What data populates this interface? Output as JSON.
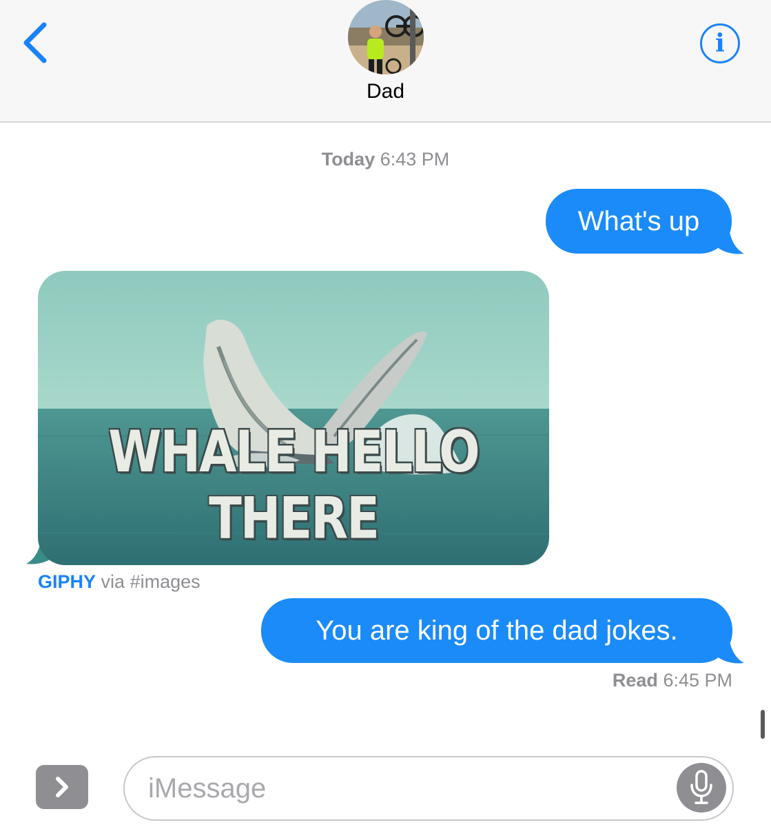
{
  "header": {
    "contact_name": "Dad",
    "info_glyph": "i",
    "back_icon": "chevron-left-icon",
    "info_icon": "info-circle-icon"
  },
  "conversation": {
    "date_label": "Today",
    "date_time": "6:43 PM",
    "messages": [
      {
        "text": "What's up",
        "sender": "me"
      },
      {
        "text": "You are king of the dad jokes.",
        "sender": "me"
      }
    ],
    "gif": {
      "caption": "WHALE HELLO THERE",
      "source_app": "GIPHY",
      "source_suffix": "via #images"
    },
    "read_label": "Read",
    "read_time": "6:45 PM"
  },
  "input": {
    "placeholder": "iMessage",
    "apps_icon": "chevron-right-icon",
    "mic_icon": "microphone-icon"
  },
  "colors": {
    "accent": "#1a82fb",
    "bubble": "#1b8bf9",
    "secondary_text": "#8e8e93"
  }
}
